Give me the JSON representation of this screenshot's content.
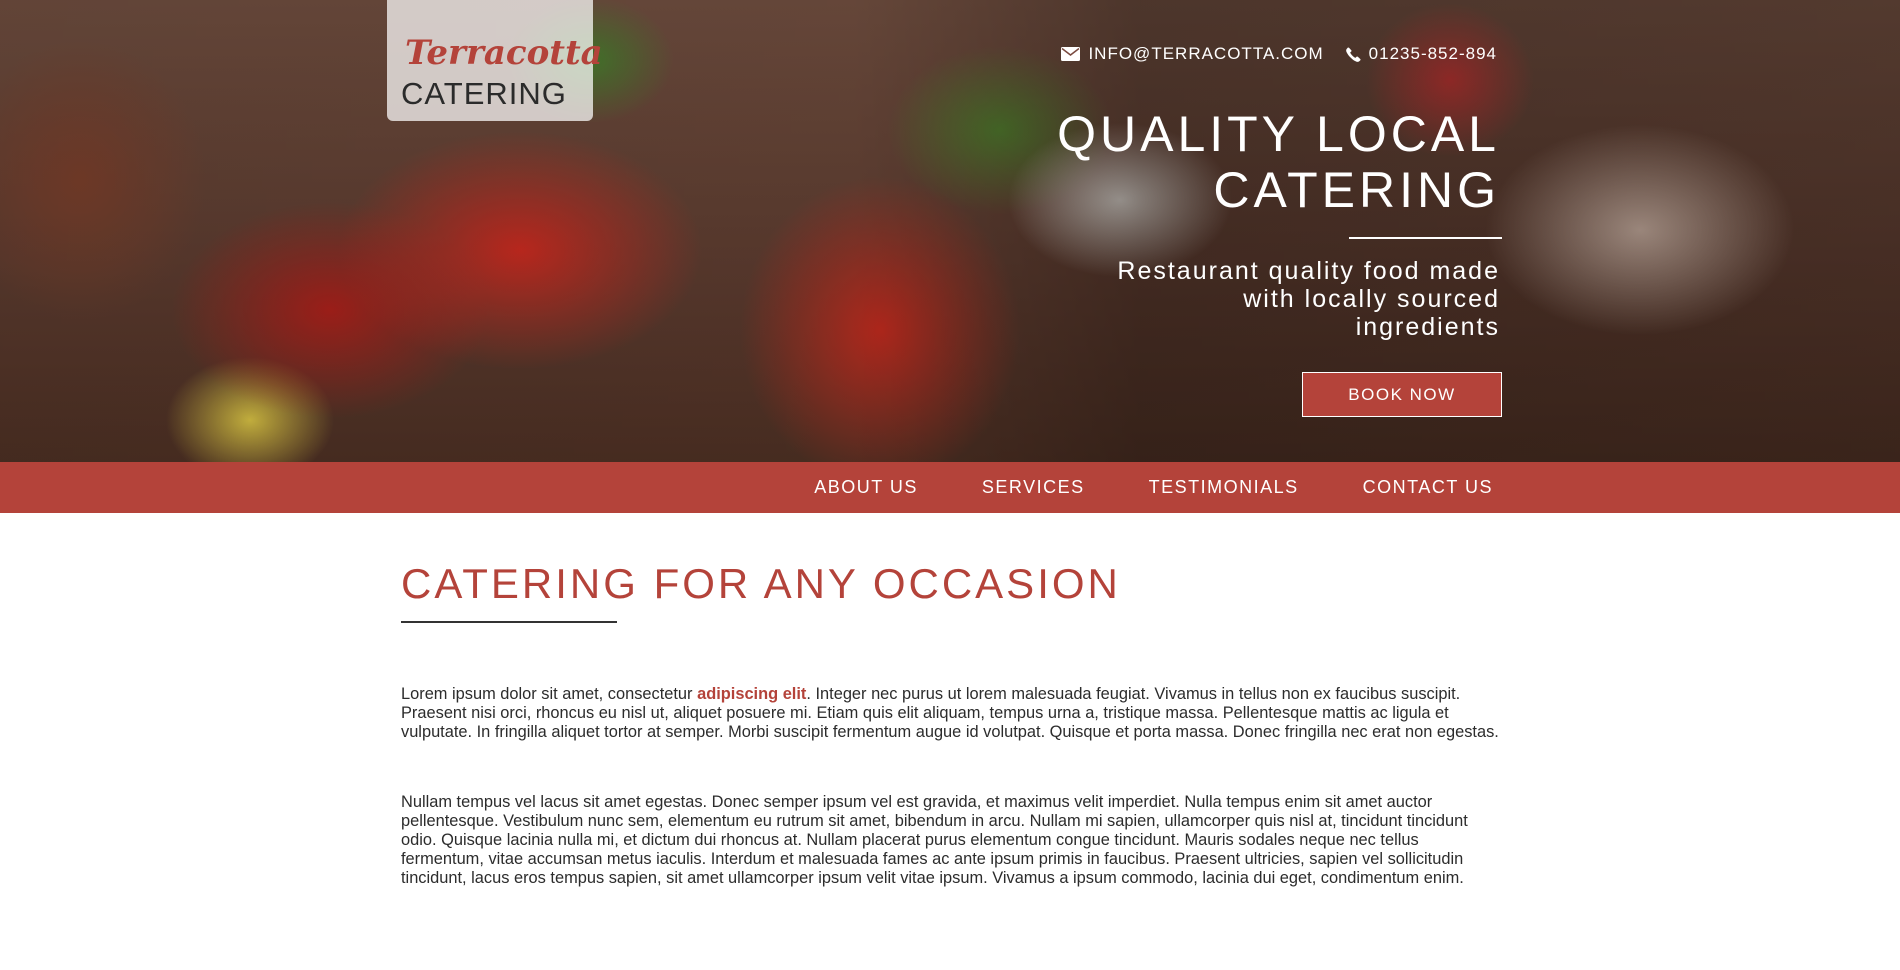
{
  "brand": {
    "script_name": "Terracotta",
    "word": "CATERING"
  },
  "contact": {
    "email": "INFO@TERRACOTTA.COM",
    "phone": "01235-852-894",
    "email_icon": "envelope-icon",
    "phone_icon": "phone-icon"
  },
  "hero": {
    "title_line1": "QUALITY LOCAL",
    "title_line2": "CATERING",
    "subtitle_line1": "Restaurant quality food made",
    "subtitle_line2": "with locally sourced",
    "subtitle_line3": "ingredients",
    "button_label": "BOOK NOW"
  },
  "nav": {
    "items": [
      {
        "label": "ABOUT US"
      },
      {
        "label": "SERVICES"
      },
      {
        "label": "TESTIMONIALS"
      },
      {
        "label": "CONTACT US"
      }
    ]
  },
  "main": {
    "section_title": "CATERING FOR ANY OCCASION",
    "para1_before": "Lorem ipsum dolor sit amet, consectetur ",
    "para1_link": "adipiscing elit",
    "para1_after": ". Integer nec purus ut lorem malesuada feugiat. Vivamus in tellus non ex faucibus suscipit. Praesent nisi orci, rhoncus eu nisl ut, aliquet posuere mi. Etiam quis elit aliquam, tempus urna a, tristique massa. Pellentesque mattis ac ligula et vulputate. In fringilla aliquet tortor at semper. Morbi suscipit fermentum augue id volutpat. Quisque et porta massa. Donec fringilla nec erat non egestas.",
    "para2": "Nullam tempus vel lacus sit amet egestas. Donec semper ipsum vel est gravida, et maximus velit imperdiet. Nulla tempus enim sit amet auctor pellentesque. Vestibulum nunc sem, elementum eu rutrum sit amet, bibendum in arcu. Nullam mi sapien, ullamcorper quis nisl at, tincidunt tincidunt odio. Quisque lacinia nulla mi, et dictum dui rhoncus at. Nullam placerat purus elementum congue tincidunt. Mauris sodales neque nec tellus fermentum, vitae accumsan metus iaculis. Interdum et malesuada fames ac ante ipsum primis in faucibus. Praesent ultricies, sapien vel sollicitudin tincidunt, lacus eros tempus sapien, sit amet ullamcorper ipsum velit vitae ipsum. Vivamus a ipsum commodo, lacinia dui eget, condimentum enim."
  },
  "colors": {
    "accent": "#b4433a",
    "text": "#2c2c2c"
  }
}
